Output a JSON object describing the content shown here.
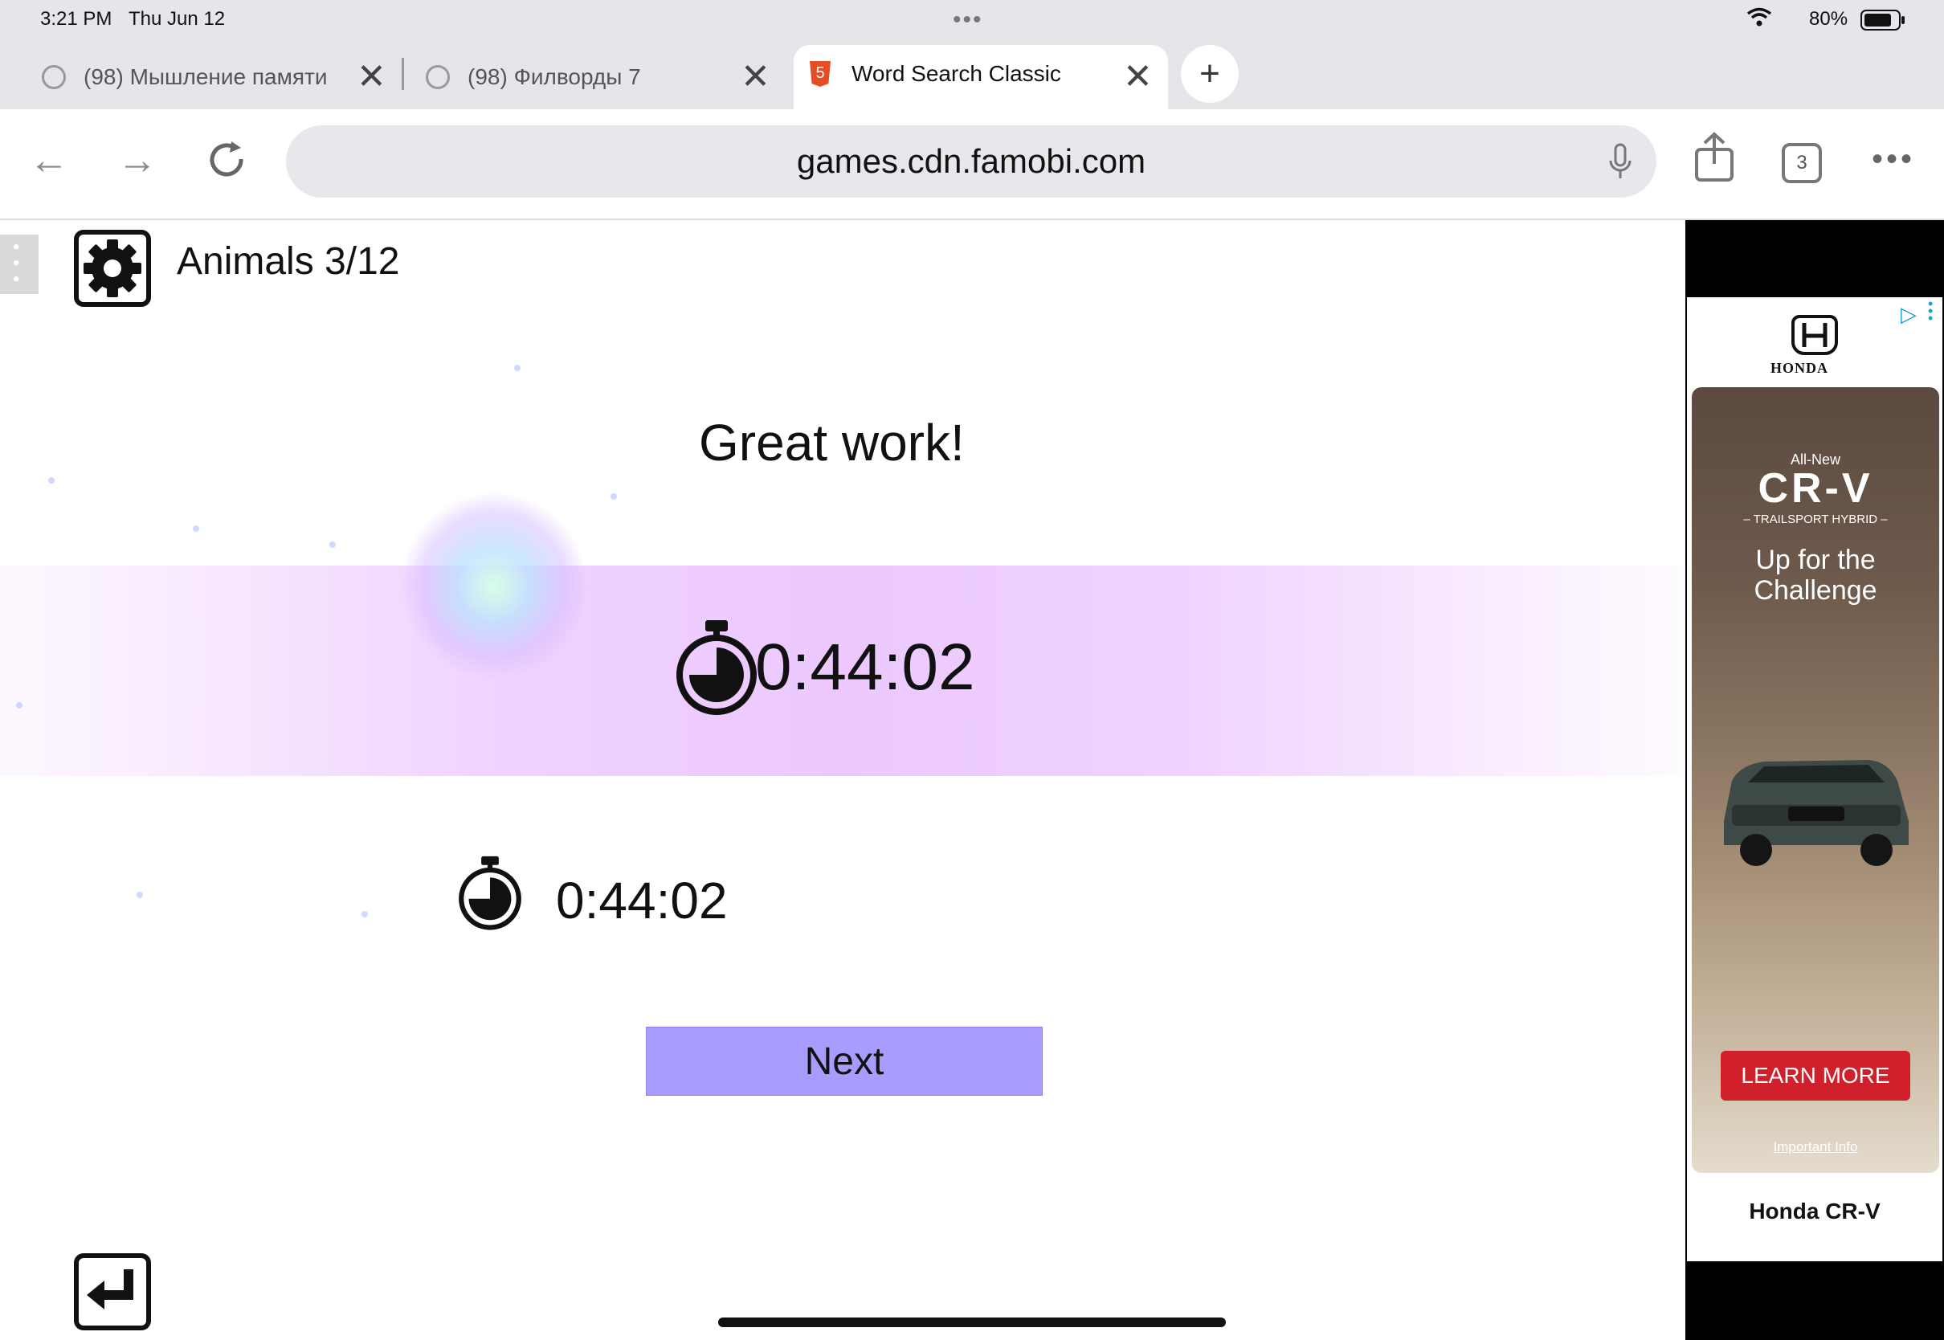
{
  "status_bar": {
    "time": "3:21 PM",
    "date": "Thu Jun 12",
    "battery": "80%"
  },
  "tabs": [
    {
      "label": "(98) Мышление памяти"
    },
    {
      "label": "(98) Филворды 7"
    },
    {
      "label": "Word Search Classic"
    }
  ],
  "toolbar": {
    "url": "games.cdn.famobi.com",
    "tab_count": "3"
  },
  "game": {
    "level_title": "Animals 3/12",
    "headline": "Great work!",
    "time_main": "0:44:02",
    "time_best": "0:44:02",
    "next_label": "Next"
  },
  "ad": {
    "brand": "HONDA",
    "kicker": "All-New",
    "model": "CR-V",
    "trim": "– TRAILSPORT HYBRID –",
    "tagline": "Up for the Challenge",
    "cta": "LEARN MORE",
    "info": "Important Info",
    "footer": "Honda CR-V"
  },
  "colors": {
    "next_button": "#a89cff",
    "band": "#ecc8ff",
    "ad_cta": "#d0202c"
  }
}
